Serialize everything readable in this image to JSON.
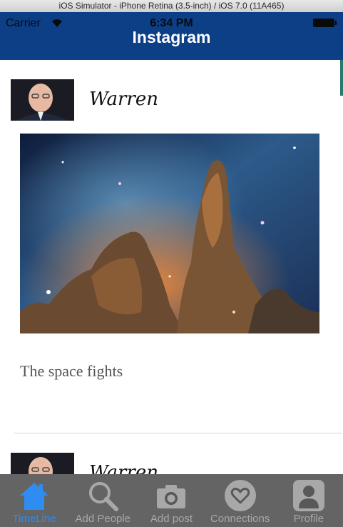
{
  "simulator": {
    "title": "iOS Simulator - iPhone Retina (3.5-inch) / iOS 7.0 (11A465)"
  },
  "status_bar": {
    "carrier": "Carrier",
    "time": "6:34 PM"
  },
  "nav": {
    "title": "Instagram"
  },
  "posts": [
    {
      "username": "Warren",
      "caption": "The space fights"
    },
    {
      "username": "Warren"
    }
  ],
  "tabs": [
    {
      "label": "TimeLine",
      "icon": "home-icon",
      "active": true
    },
    {
      "label": "Add People",
      "icon": "search-icon"
    },
    {
      "label": "Add post",
      "icon": "camera-icon"
    },
    {
      "label": "Connections",
      "icon": "heart-icon"
    },
    {
      "label": "Profile",
      "icon": "profile-icon"
    }
  ],
  "colors": {
    "nav_bg": "#0d3f86",
    "tab_active": "#2f8cf0",
    "tab_bar": "#585858"
  }
}
